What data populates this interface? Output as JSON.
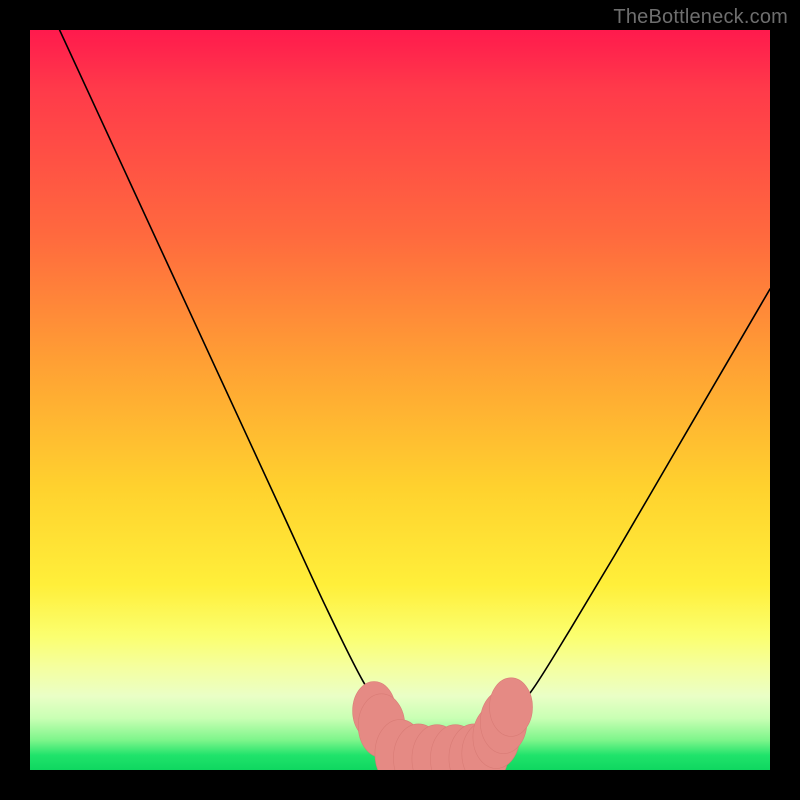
{
  "watermark": {
    "text": "TheBottleneck.com"
  },
  "colors": {
    "curve_stroke": "#000000",
    "marker_fill": "#e58a84",
    "marker_stroke": "#d97c76"
  },
  "chart_data": {
    "type": "line",
    "title": "",
    "xlabel": "",
    "ylabel": "",
    "xlim": [
      0,
      100
    ],
    "ylim": [
      0,
      100
    ],
    "grid": false,
    "legend": false,
    "series": [
      {
        "name": "left-curve",
        "x": [
          4,
          10,
          16,
          22,
          28,
          34,
          40,
          45,
          49,
          52,
          54
        ],
        "y": [
          100,
          87,
          74,
          61,
          48,
          35,
          22,
          12,
          6,
          3,
          2
        ]
      },
      {
        "name": "right-curve",
        "x": [
          58,
          61,
          64,
          68,
          73,
          79,
          86,
          93,
          100
        ],
        "y": [
          2,
          3,
          6,
          11,
          19,
          29,
          41,
          53,
          65
        ]
      },
      {
        "name": "floor",
        "x": [
          48,
          52,
          56,
          60,
          64
        ],
        "y": [
          2,
          1.6,
          1.5,
          1.6,
          2
        ]
      }
    ],
    "markers": [
      {
        "x": 46.5,
        "y": 8,
        "r": 2.4
      },
      {
        "x": 47.5,
        "y": 6,
        "r": 2.6
      },
      {
        "x": 50,
        "y": 2.2,
        "r": 2.8
      },
      {
        "x": 52.5,
        "y": 1.6,
        "r": 2.8
      },
      {
        "x": 55,
        "y": 1.5,
        "r": 2.8
      },
      {
        "x": 57.5,
        "y": 1.5,
        "r": 2.8
      },
      {
        "x": 60,
        "y": 1.6,
        "r": 2.8
      },
      {
        "x": 61.5,
        "y": 2.2,
        "r": 2.6
      },
      {
        "x": 63,
        "y": 4.5,
        "r": 2.6
      },
      {
        "x": 64,
        "y": 6.5,
        "r": 2.6
      },
      {
        "x": 65,
        "y": 8.5,
        "r": 2.4
      }
    ]
  }
}
